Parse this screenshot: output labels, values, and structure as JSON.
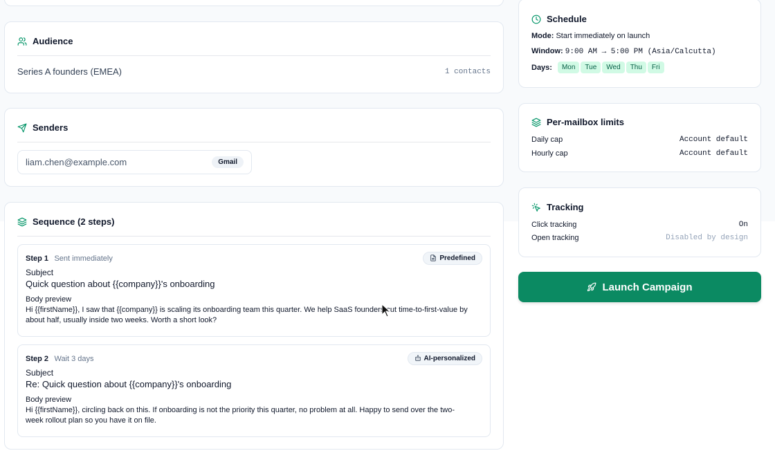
{
  "audience": {
    "title": "Audience",
    "segment": "Series A founders (EMEA)",
    "contacts": "1 contacts"
  },
  "senders": {
    "title": "Senders",
    "email": "liam.chen@example.com",
    "provider": "Gmail"
  },
  "sequence": {
    "title": "Sequence (2 steps)",
    "steps": [
      {
        "label": "Step 1",
        "timing": "Sent immediately",
        "badge": "Predefined",
        "subject_label": "Subject",
        "subject": "Quick question about {{company}}'s onboarding",
        "body_label": "Body preview",
        "body": "Hi {{firstName}}, I saw that {{company}} is scaling its onboarding team this quarter. We help SaaS founders cut time-to-first-value by about half, usually inside two weeks. Worth a short look?"
      },
      {
        "label": "Step 2",
        "timing": "Wait 3 days",
        "badge": "AI-personalized",
        "subject_label": "Subject",
        "subject": "Re: Quick question about {{company}}'s onboarding",
        "body_label": "Body preview",
        "body": "Hi {{firstName}}, circling back on this. If onboarding is not the priority this quarter, no problem at all. Happy to send over the two-week rollout plan so you have it on file."
      }
    ]
  },
  "schedule": {
    "title": "Schedule",
    "mode_label": "Mode:",
    "mode": "Start immediately on launch",
    "window_label": "Window:",
    "window": "9:00 AM → 5:00 PM (Asia/Calcutta)",
    "days_label": "Days:",
    "days": [
      "Mon",
      "Tue",
      "Wed",
      "Thu",
      "Fri"
    ]
  },
  "limits": {
    "title": "Per-mailbox limits",
    "daily_label": "Daily cap",
    "daily_value": "Account default",
    "hourly_label": "Hourly cap",
    "hourly_value": "Account default"
  },
  "tracking": {
    "title": "Tracking",
    "click_label": "Click tracking",
    "click_value": "On",
    "open_label": "Open tracking",
    "open_value": "Disabled by design"
  },
  "launch": {
    "label": "Launch Campaign"
  },
  "colors": {
    "accent": "#0b8a62",
    "day_chip": "#d1fae5"
  }
}
